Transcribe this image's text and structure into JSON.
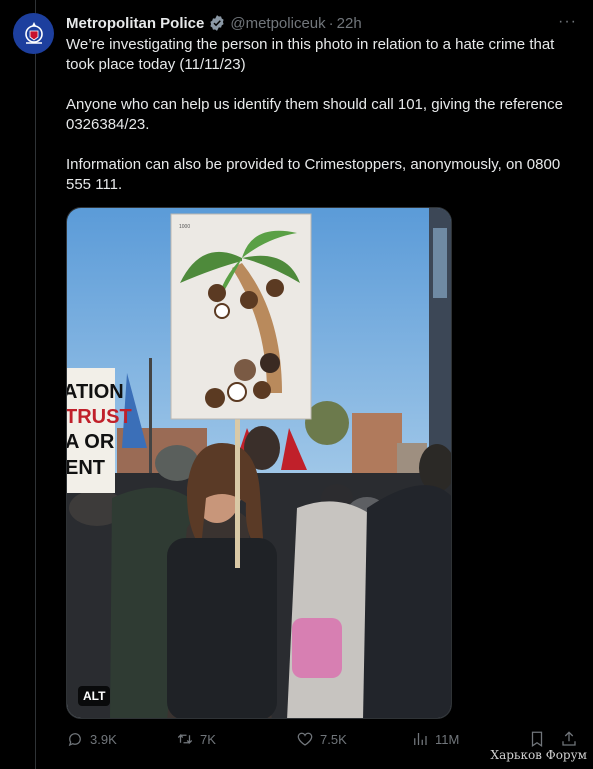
{
  "author": {
    "name": "Metropolitan Police",
    "handle": "@metpoliceuk",
    "time": "22h"
  },
  "tweet": {
    "paragraphs": [
      "We’re investigating the person in this photo in relation to a hate crime that took place today (11/11/23)",
      "Anyone who can help us identify them should call 101, giving the reference 0326384/23.",
      "Information can also be provided to Crimestoppers, anonymously, on 0800 555 111."
    ]
  },
  "media": {
    "alt_label": "ALT",
    "placard_top_text": "ATION",
    "placard_lines": [
      "TRUST",
      "A OR",
      "ENT"
    ],
    "sign_corner_text": "1000"
  },
  "actions": {
    "replies": "3.9K",
    "reposts": "7K",
    "likes": "7.5K",
    "views": "11M"
  },
  "watermark": "Харьков Форум",
  "colors": {
    "background": "#000000",
    "text": "#e7e9ea",
    "muted": "#71767b",
    "verified": "#1d9bf0",
    "avatar": "#1d3f9e"
  }
}
